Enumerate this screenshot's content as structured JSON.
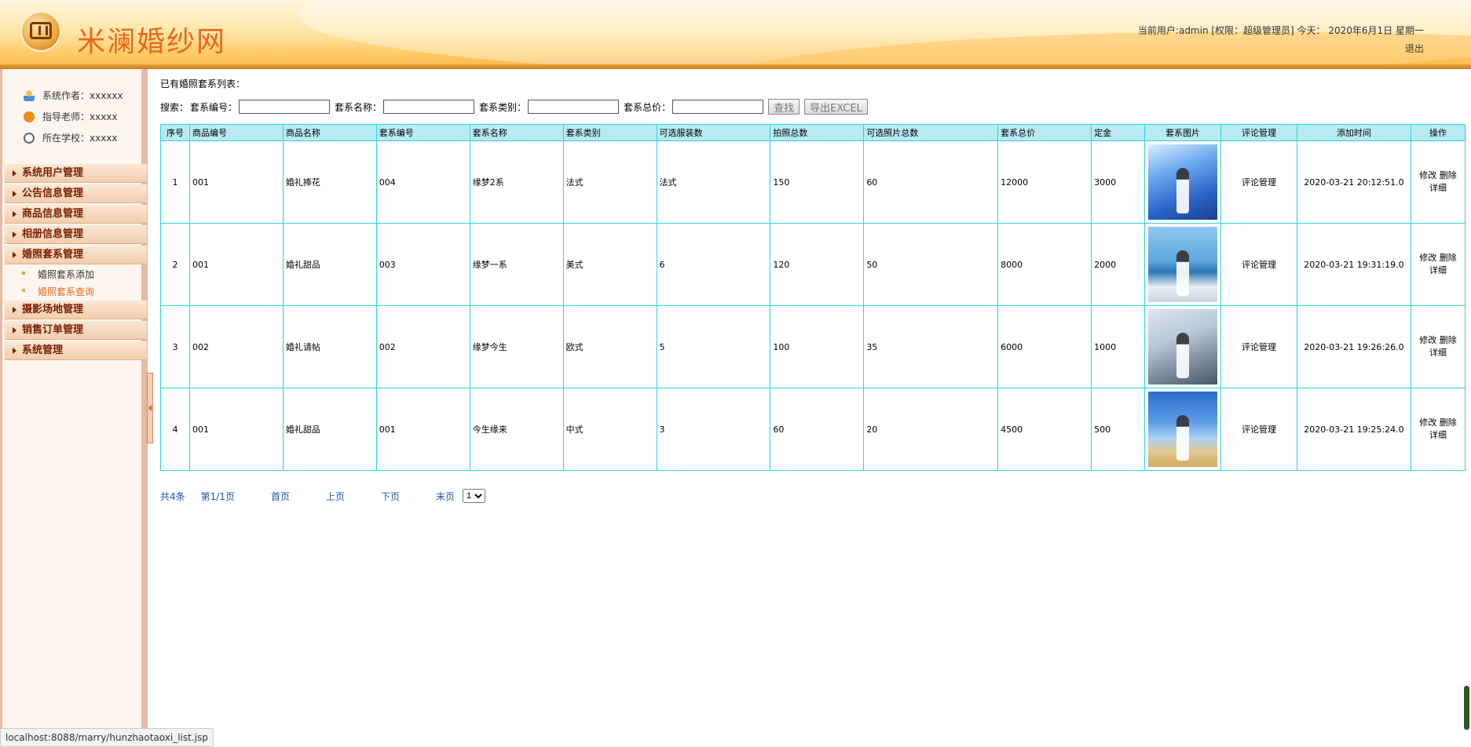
{
  "header": {
    "site_title": "米澜婚纱网",
    "user_info": "当前用户:admin [权限：超级管理员] 今天：  2020年6月1日 星期一",
    "logout": "退出"
  },
  "sidebar": {
    "author": "系统作者：xxxxxx",
    "teacher": "指导老师：xxxxx",
    "school": "所在学校：xxxxx",
    "groups": [
      "系统用户管理",
      "公告信息管理",
      "商品信息管理",
      "相册信息管理",
      "婚照套系管理",
      "摄影场地管理",
      "销售订单管理",
      "系统管理"
    ],
    "subitems": [
      "婚照套系添加",
      "婚照套系查询"
    ]
  },
  "main": {
    "list_title": "已有婚照套系列表：",
    "search": {
      "label": "搜索：",
      "code_label": "套系编号：",
      "name_label": "套系名称：",
      "type_label": "套系类别：",
      "price_label": "套系总价：",
      "search_btn": "查找",
      "export_btn": "导出EXCEL"
    },
    "columns": [
      "序号",
      "商品编号",
      "商品名称",
      "套系编号",
      "套系名称",
      "套系类别",
      "可选服装数",
      "拍照总数",
      "可选照片总数",
      "套系总价",
      "定金",
      "套系图片",
      "评论管理",
      "添加时间",
      "操作"
    ],
    "rows": [
      {
        "no": "1",
        "goods_code": "001",
        "goods_name": "婚礼捧花",
        "set_code": "004",
        "set_name": "缘梦2系",
        "set_type": "法式",
        "clothes": "法式",
        "photos": "150",
        "select_photos": "60",
        "price": "12000",
        "deposit": "3000",
        "comment": "评论管理",
        "time": "2020-03-21 20:12:51.0",
        "edit": "修改",
        "del": "删除",
        "detail": "详细"
      },
      {
        "no": "2",
        "goods_code": "001",
        "goods_name": "婚礼甜品",
        "set_code": "003",
        "set_name": "缘梦一系",
        "set_type": "美式",
        "clothes": "6",
        "photos": "120",
        "select_photos": "50",
        "price": "8000",
        "deposit": "2000",
        "comment": "评论管理",
        "time": "2020-03-21 19:31:19.0",
        "edit": "修改",
        "del": "删除",
        "detail": "详细"
      },
      {
        "no": "3",
        "goods_code": "002",
        "goods_name": "婚礼请帖",
        "set_code": "002",
        "set_name": "缘梦今生",
        "set_type": "欧式",
        "clothes": "5",
        "photos": "100",
        "select_photos": "35",
        "price": "6000",
        "deposit": "1000",
        "comment": "评论管理",
        "time": "2020-03-21 19:26:26.0",
        "edit": "修改",
        "del": "删除",
        "detail": "详细"
      },
      {
        "no": "4",
        "goods_code": "001",
        "goods_name": "婚礼甜品",
        "set_code": "001",
        "set_name": "今生缘来",
        "set_type": "中式",
        "clothes": "3",
        "photos": "60",
        "select_photos": "20",
        "price": "4500",
        "deposit": "500",
        "comment": "评论管理",
        "time": "2020-03-21 19:25:24.0",
        "edit": "修改",
        "del": "删除",
        "detail": "详细"
      }
    ],
    "pager": {
      "total": "共4条",
      "page": "第1/1页",
      "first": "首页",
      "prev": "上页",
      "next": "下页",
      "last": "末页",
      "select": "1"
    }
  },
  "status_url": "localhost:8088/marry/hunzhaotaoxi_list.jsp",
  "colors": {
    "header_title": "#e8681c",
    "table_border": "#2ed1de",
    "table_header": "#b8eaf3",
    "menu_text": "#7a1e00",
    "active_sub": "#e8681c",
    "link": "#1a55b0"
  }
}
